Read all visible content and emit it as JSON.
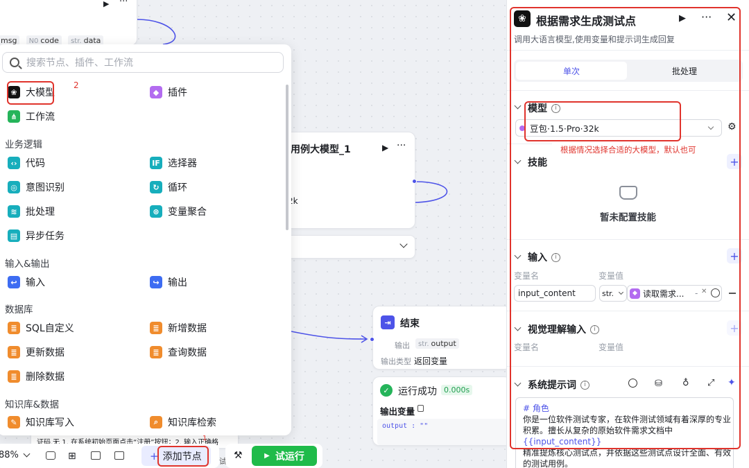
{
  "canvas": {
    "top_node": {
      "output_tags": [
        {
          "type": "",
          "name": "msg"
        },
        {
          "type": "N0",
          "name": "code"
        },
        {
          "type": "str",
          "name": "data"
        }
      ]
    },
    "llm_node": {
      "title": "用例大模型_1",
      "partial_value": "2k"
    },
    "end_node": {
      "title": "结束",
      "output_label": "输出",
      "output_tag_type": "str.",
      "output_tag_name": "output",
      "output_type_label": "输出类型",
      "output_type_value": "返回变量"
    },
    "run_result": {
      "status": "运行成功",
      "time": "0.000s",
      "output_label": "输出变量",
      "output_code": "output : \"\""
    },
    "partial_text": "证码.无 1. 在系统初始页面点击“注册”按钮；2. 输入正确格"
  },
  "node_panel": {
    "search_placeholder": "搜索节点、插件、工作流",
    "items_top": [
      {
        "label": "大模型",
        "icon": "llm-icon",
        "color": "#111111"
      },
      {
        "label": "插件",
        "icon": "plugin-icon",
        "color": "#b36cf0"
      },
      {
        "label": "工作流",
        "icon": "workflow-icon",
        "color": "#25b45a"
      }
    ],
    "sections": [
      {
        "title": "业务逻辑"
      },
      {
        "title": "输入&输出"
      },
      {
        "title": "数据库"
      },
      {
        "title": "知识库&数据"
      }
    ],
    "logic_items": [
      "代码",
      "选择器",
      "意图识别",
      "循环",
      "批处理",
      "变量聚合",
      "异步任务"
    ],
    "io_items": [
      "输入",
      "输出"
    ],
    "db_items": [
      "SQL自定义",
      "新增数据",
      "更新数据",
      "查询数据",
      "删除数据"
    ],
    "kb_items": [
      "知识库写入",
      "知识库检索"
    ],
    "annotation_2": "2"
  },
  "toolbar": {
    "zoom": "88%",
    "add_node": "添加节点",
    "annotation_1": "1",
    "test_run": "试运行",
    "partial_label": "试"
  },
  "right_panel": {
    "title": "根据需求生成测试点",
    "description": "调用大语言模型,使用变量和提示词生成回复",
    "tabs": [
      "单次",
      "批处理"
    ],
    "model_label": "模型",
    "model_value": "豆包·1.5·Pro·32k",
    "model_annotation": "根据情况选择合适的大模型，默认也可",
    "skills_label": "技能",
    "skills_empty": "暂未配置技能",
    "input_label": "输入",
    "var_name_label": "变量名",
    "var_value_label": "变量值",
    "input_var_name": "input_content",
    "input_var_type": "str.",
    "input_var_ref": "读取需求...",
    "input_var_ref_sep": "-",
    "visual_label": "视觉理解输入",
    "system_prompt_label": "系统提示词",
    "prompt_heading": "# 角色",
    "prompt_line1": "你是一位软件测试专家，在软件测试领域有着深厚的专业",
    "prompt_line2a": "积累。擅长从复杂的原始软件需求文档中",
    "prompt_var": "{{input_content}}",
    "prompt_line3": "精准提炼核心测试点，并依据这些测试点设计全面、有效",
    "prompt_line4": "的测试用例。"
  }
}
